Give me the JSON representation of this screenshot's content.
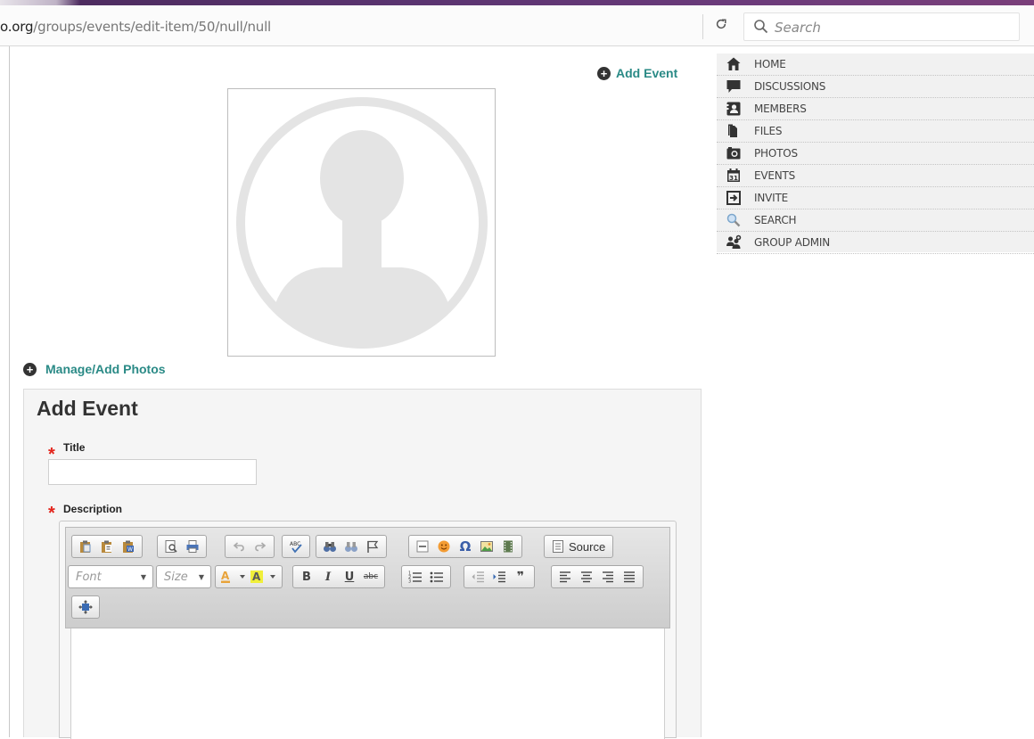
{
  "browser": {
    "url_domain": "o.org",
    "url_path": "/groups/events/edit-item/50/null/null",
    "reload_icon": "reload-icon",
    "search_placeholder": "Search"
  },
  "page": {
    "add_event_link": "Add Event",
    "manage_photos_link": "Manage/Add Photos"
  },
  "sidebar": {
    "items": [
      {
        "label": "HOME",
        "icon": "home-icon"
      },
      {
        "label": "DISCUSSIONS",
        "icon": "discussions-icon"
      },
      {
        "label": "MEMBERS",
        "icon": "members-icon"
      },
      {
        "label": "FILES",
        "icon": "files-icon"
      },
      {
        "label": "PHOTOS",
        "icon": "camera-icon"
      },
      {
        "label": "EVENTS",
        "icon": "calendar-icon"
      },
      {
        "label": "INVITE",
        "icon": "invite-icon"
      },
      {
        "label": "SEARCH",
        "icon": "search-icon"
      },
      {
        "label": "GROUP ADMIN",
        "icon": "group-admin-icon"
      }
    ]
  },
  "form": {
    "heading": "Add Event",
    "title_label": "Title",
    "title_value": "",
    "description_label": "Description",
    "required_marker": "*"
  },
  "editor": {
    "source_label": "Source",
    "font_placeholder": "Font",
    "size_placeholder": "Size",
    "bold": "B",
    "italic": "I",
    "underline": "U",
    "strike": "abc",
    "omega": "Ω",
    "quote": "❞"
  },
  "colors": {
    "accent_teal": "#2a8a86",
    "required_red": "#e3241b",
    "header_purple": "#5a3470"
  }
}
